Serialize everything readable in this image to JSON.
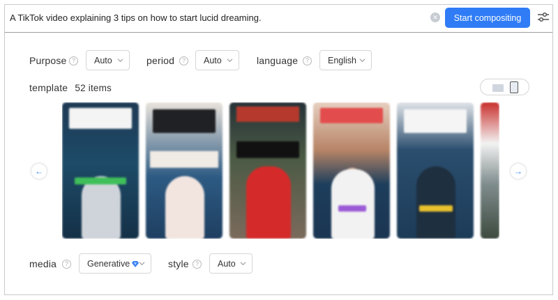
{
  "prompt": {
    "text": "A TikTok video explaining 3 tips on how to start lucid dreaming.",
    "clear_icon": "clear-icon",
    "compose_label": "Start compositing",
    "settings_icon": "sliders-icon"
  },
  "filters": {
    "purpose": {
      "label": "Purpose",
      "value": "Auto"
    },
    "period": {
      "label": "period",
      "value": "Auto"
    },
    "language": {
      "label": "language",
      "value": "English"
    }
  },
  "template": {
    "label": "template",
    "count": "52 items",
    "view_modes": [
      "landscape",
      "portrait"
    ],
    "selected_view": "portrait"
  },
  "media": {
    "label": "media",
    "value": "Generative",
    "badge_icon": "diamond-icon"
  },
  "style": {
    "label": "style",
    "value": "Auto"
  },
  "colors": {
    "accent": "#2f7cf6"
  }
}
